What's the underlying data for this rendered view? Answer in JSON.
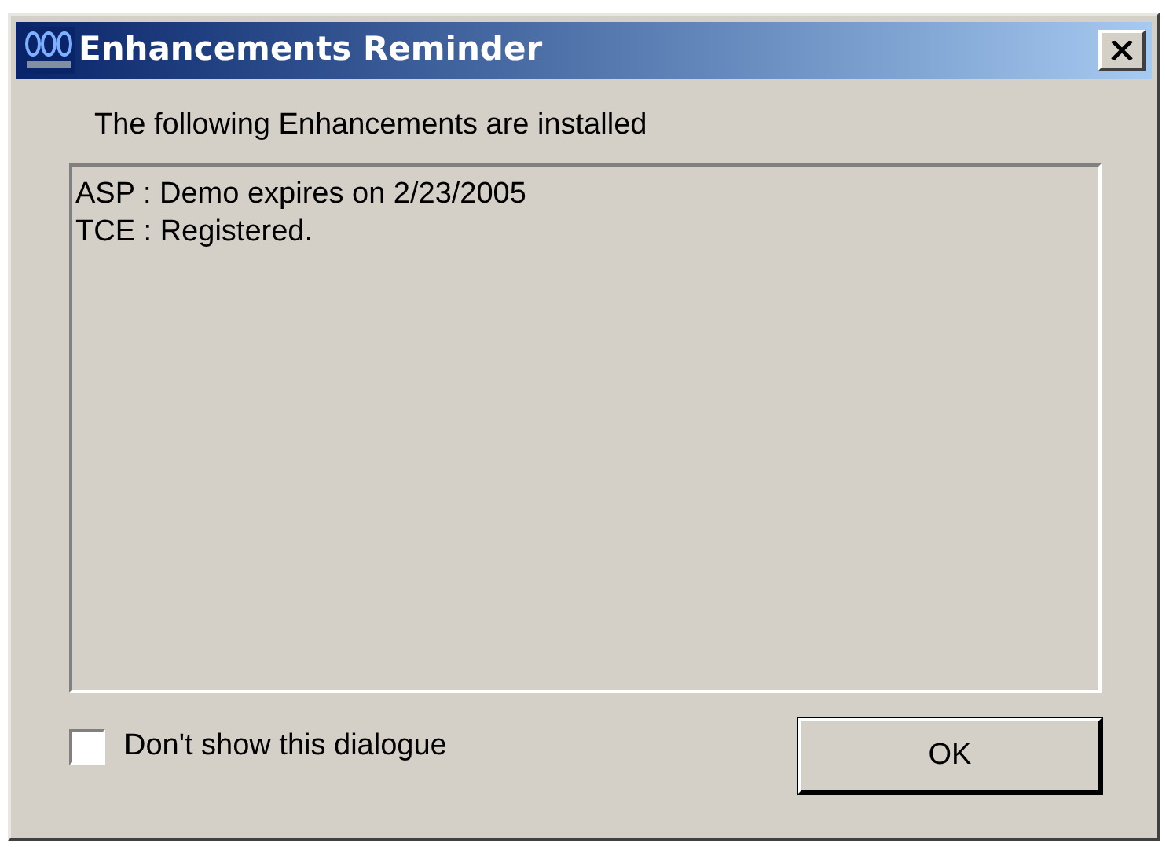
{
  "window": {
    "title": "Enhancements Reminder"
  },
  "intro": "The following Enhancements are installed",
  "list_lines": [
    "ASP : Demo expires on 2/23/2005",
    "TCE : Registered."
  ],
  "checkbox": {
    "label": "Don't show this dialogue",
    "checked": false
  },
  "buttons": [
    {
      "label": "OK"
    }
  ]
}
